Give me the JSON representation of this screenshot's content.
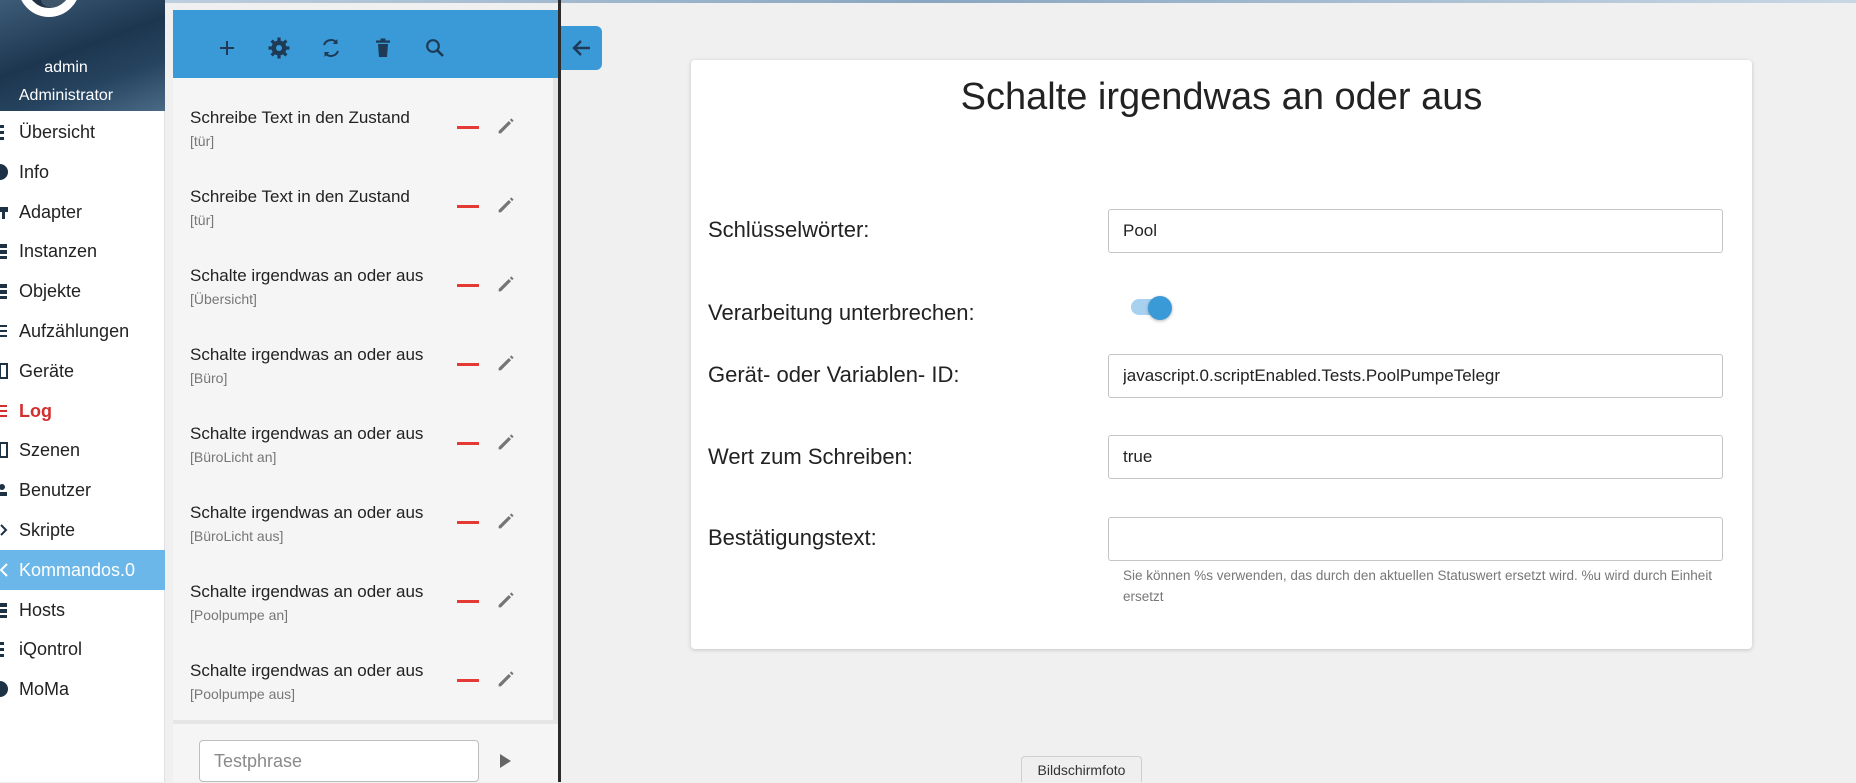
{
  "user": {
    "name": "admin",
    "role": "Administrator"
  },
  "nav": {
    "items": [
      {
        "label": "Übersicht",
        "icon": "list-icon"
      },
      {
        "label": "Info",
        "icon": "info-icon"
      },
      {
        "label": "Adapter",
        "icon": "adapter-icon"
      },
      {
        "label": "Instanzen",
        "icon": "instances-icon"
      },
      {
        "label": "Objekte",
        "icon": "objects-icon"
      },
      {
        "label": "Aufzählungen",
        "icon": "enum-icon"
      },
      {
        "label": "Geräte",
        "icon": "devices-icon"
      },
      {
        "label": "Log",
        "icon": "log-icon"
      },
      {
        "label": "Szenen",
        "icon": "scenes-icon"
      },
      {
        "label": "Benutzer",
        "icon": "users-icon"
      },
      {
        "label": "Skripte",
        "icon": "scripts-icon"
      },
      {
        "label": "Kommandos.0",
        "icon": "commands-icon"
      },
      {
        "label": "Hosts",
        "icon": "hosts-icon"
      },
      {
        "label": "iQontrol",
        "icon": "iqontrol-icon"
      },
      {
        "label": "MoMa",
        "icon": "moma-icon"
      }
    ],
    "active": "Kommandos.0",
    "highlight": "Log"
  },
  "toolbar": {
    "icons": [
      "add-icon",
      "gear-icon",
      "refresh-icon",
      "delete-icon",
      "search-icon"
    ]
  },
  "rules": [
    {
      "title": "Schreibe Text in den Zustand",
      "subtitle": "[tür]"
    },
    {
      "title": "Schreibe Text in den Zustand",
      "subtitle": "[tür]"
    },
    {
      "title": "Schalte irgendwas an oder aus",
      "subtitle": "[Übersicht]"
    },
    {
      "title": "Schalte irgendwas an oder aus",
      "subtitle": "[Büro]"
    },
    {
      "title": "Schalte irgendwas an oder aus",
      "subtitle": "[BüroLicht an]"
    },
    {
      "title": "Schalte irgendwas an oder aus",
      "subtitle": "[BüroLicht aus]"
    },
    {
      "title": "Schalte irgendwas an oder aus",
      "subtitle": "[Poolpumpe an]"
    },
    {
      "title": "Schalte irgendwas an oder aus",
      "subtitle": "[Poolpumpe aus]"
    }
  ],
  "test": {
    "placeholder": "Testphrase",
    "value": ""
  },
  "editor": {
    "title": "Schalte irgendwas an oder aus",
    "keywords_label": "Schlüsselwörter:",
    "keywords_value": "Pool",
    "break_label": "Verarbeitung unterbrechen:",
    "break_on": true,
    "device_label": "Gerät- oder Variablen- ID:",
    "device_value": "javascript.0.scriptEnabled.Tests.PoolPumpeTelegr",
    "write_label": "Wert zum Schreiben:",
    "write_value": "true",
    "ack_label": "Bestätigungstext:",
    "ack_value": "",
    "ack_help": "Sie können %s verwenden, das durch den aktuellen Statuswert ersetzt wird. %u wird durch Einheit ersetzt"
  },
  "badge": "Bildschirmfoto",
  "colors": {
    "accent": "#3a9ad8",
    "active_nav": "#6bb7ea",
    "delete": "#e53935",
    "log": "#d32f2f"
  }
}
